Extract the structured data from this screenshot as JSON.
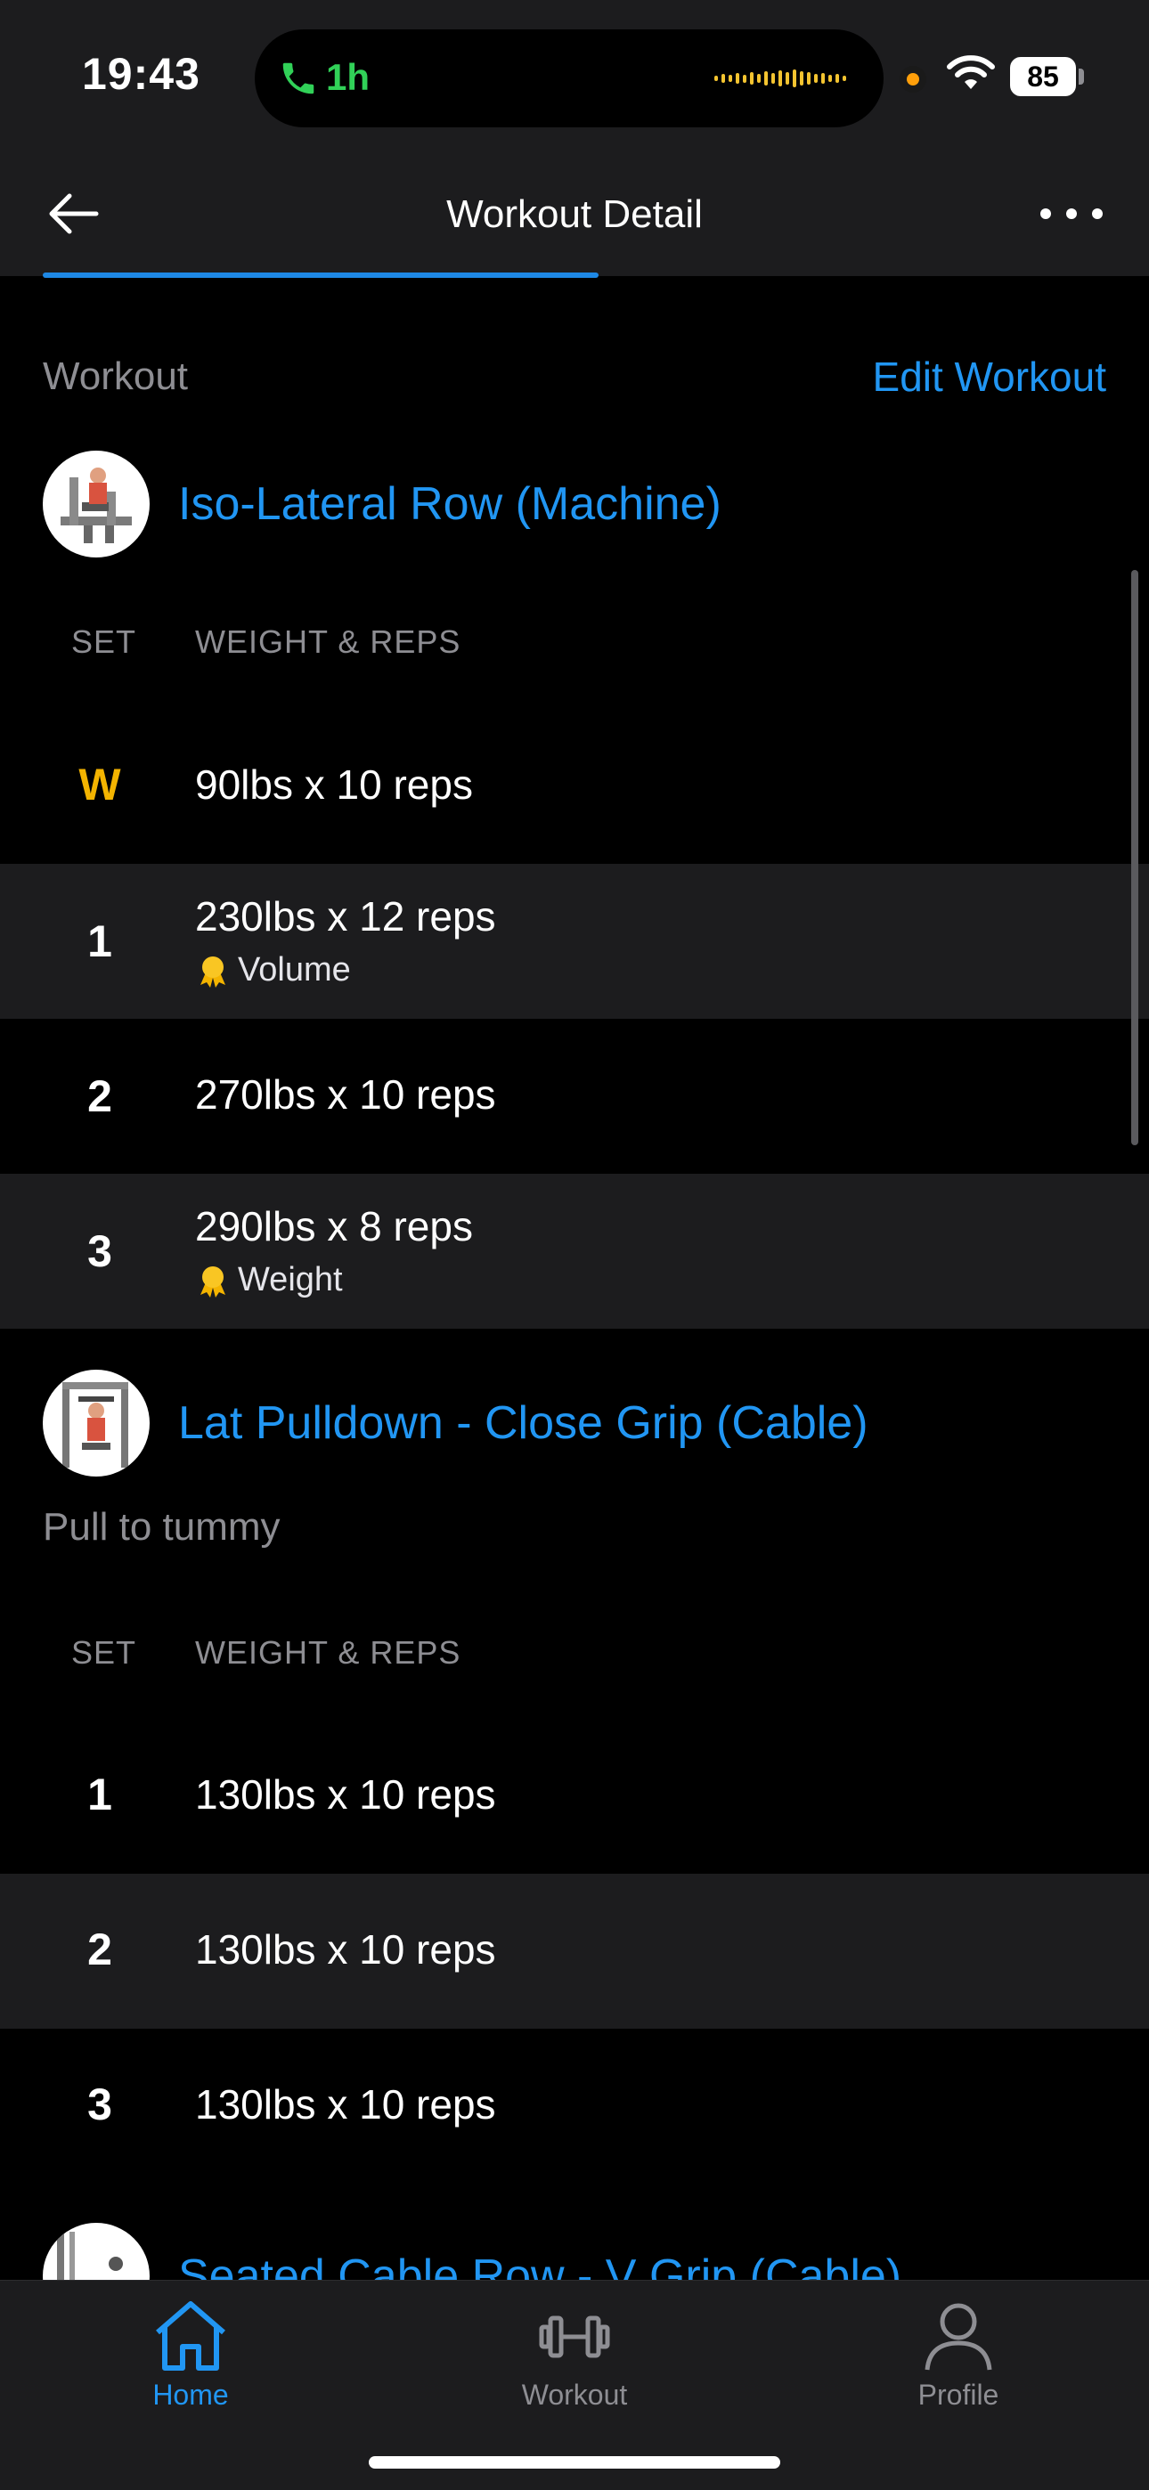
{
  "status_bar": {
    "time": "19:43",
    "call_duration": "1h",
    "battery": "85"
  },
  "nav": {
    "title": "Workout Detail"
  },
  "section": {
    "label": "Workout",
    "edit_label": "Edit Workout"
  },
  "header_columns": {
    "set": "SET",
    "weight_reps": "WEIGHT & REPS"
  },
  "exercises": [
    {
      "name": "Iso-Lateral Row (Machine)",
      "sets": [
        {
          "set": "W",
          "value": "90lbs x 10 reps"
        },
        {
          "set": "1",
          "value": "230lbs x 12 reps",
          "record": "Volume"
        },
        {
          "set": "2",
          "value": "270lbs x 10 reps"
        },
        {
          "set": "3",
          "value": "290lbs x 8 reps",
          "record": "Weight"
        }
      ]
    },
    {
      "name": "Lat Pulldown - Close Grip (Cable)",
      "note": "Pull to tummy",
      "sets": [
        {
          "set": "1",
          "value": "130lbs x 10 reps"
        },
        {
          "set": "2",
          "value": "130lbs x 10 reps"
        },
        {
          "set": "3",
          "value": "130lbs x 10 reps"
        }
      ]
    },
    {
      "name": "Seated Cable Row - V Grip (Cable)"
    }
  ],
  "tabbar": {
    "items": [
      {
        "label": "Home",
        "icon": "home-icon",
        "active": true
      },
      {
        "label": "Workout",
        "icon": "dumbbell-icon",
        "active": false
      },
      {
        "label": "Profile",
        "icon": "person-icon",
        "active": false
      }
    ]
  },
  "colors": {
    "accent": "#2196f3",
    "background": "#000000",
    "row_alt": "#1c1c1e",
    "warmup": "#f4b400",
    "call_green": "#31d158"
  }
}
